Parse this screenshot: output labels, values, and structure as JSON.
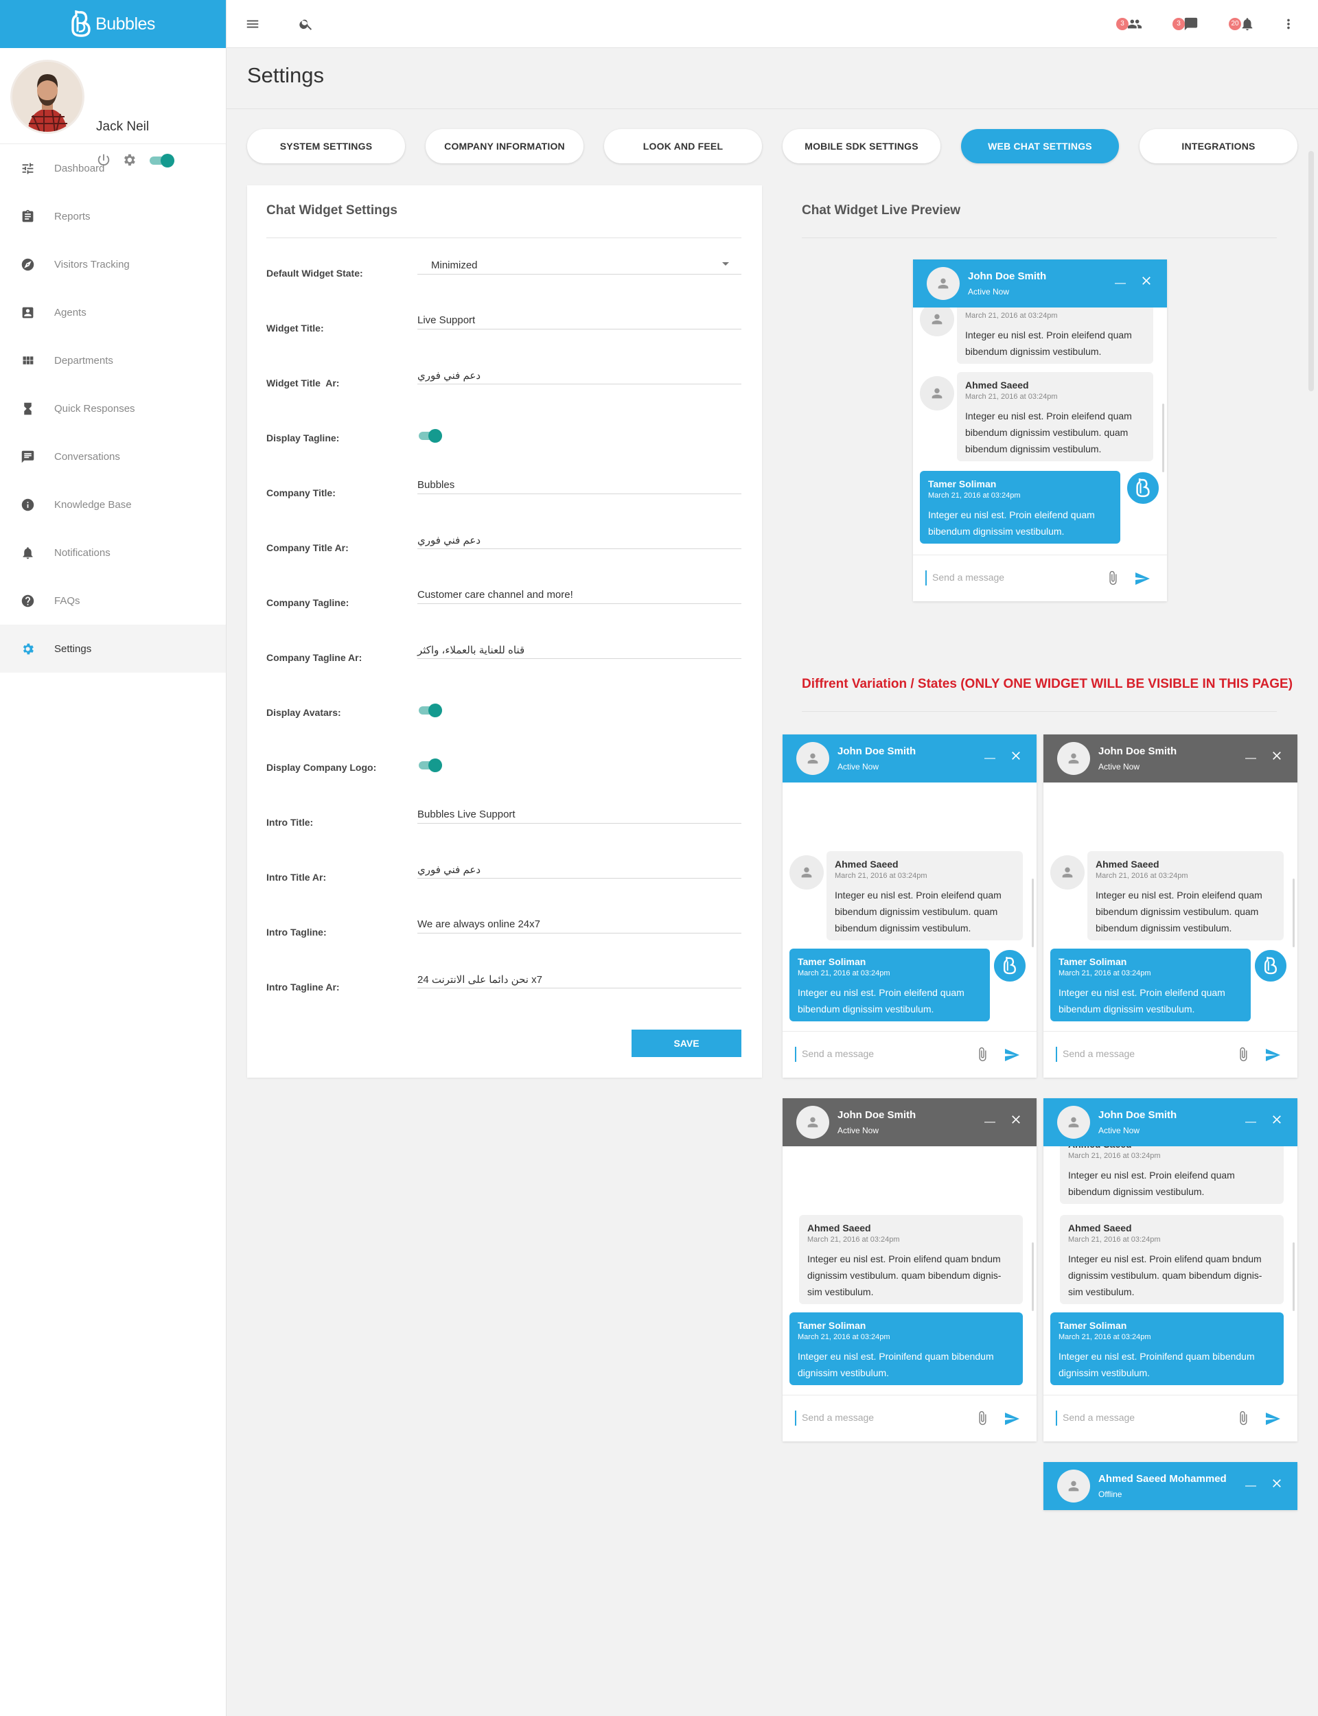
{
  "app": {
    "brand": "Bubbles"
  },
  "user": {
    "name": "Jack Neil",
    "online": true
  },
  "nav": {
    "items": [
      {
        "label": "Dashboard",
        "icon": "tune-icon"
      },
      {
        "label": "Reports",
        "icon": "clipboard-icon"
      },
      {
        "label": "Visitors Tracking",
        "icon": "compass-icon"
      },
      {
        "label": "Agents",
        "icon": "contact-icon"
      },
      {
        "label": "Departments",
        "icon": "grid-icon"
      },
      {
        "label": "Quick Responses",
        "icon": "hourglass-icon"
      },
      {
        "label": "Conversations",
        "icon": "chat-icon"
      },
      {
        "label": "Knowledge Base",
        "icon": "info-icon"
      },
      {
        "label": "Notifications",
        "icon": "bell-icon"
      },
      {
        "label": "FAQs",
        "icon": "help-icon"
      },
      {
        "label": "Settings",
        "icon": "gear-icon",
        "active": true
      }
    ]
  },
  "topbar": {
    "badges": {
      "visitors": "3",
      "chats": "3",
      "notifications": "20"
    }
  },
  "page": {
    "title": "Settings"
  },
  "tabs": [
    {
      "label": "SYSTEM SETTINGS"
    },
    {
      "label": "COMPANY INFORMATION"
    },
    {
      "label": "LOOK AND FEEL"
    },
    {
      "label": "MOBILE SDK SETTINGS"
    },
    {
      "label": "WEB CHAT SETTINGS",
      "active": true
    },
    {
      "label": "INTEGRATIONS"
    }
  ],
  "form": {
    "title": "Chat Widget Settings",
    "fields": [
      {
        "label": "Default Widget State:",
        "value": "Minimized",
        "type": "select"
      },
      {
        "label": "Widget Title:",
        "value": "Live Support"
      },
      {
        "label": "Widget Title  Ar:",
        "value": "دعم فني فوري"
      },
      {
        "label": "Display Tagline:",
        "type": "toggle",
        "on": true
      },
      {
        "label": "Company Title:",
        "value": "Bubbles"
      },
      {
        "label": "Company Title Ar:",
        "value": "دعم فني فوري"
      },
      {
        "label": "Company Tagline:",
        "value": "Customer care channel and more!"
      },
      {
        "label": "Company Tagline Ar:",
        "value": "قناه للعناية بالعملاء، واكثر"
      },
      {
        "label": "Display Avatars:",
        "type": "toggle",
        "on": true
      },
      {
        "label": "Display Company Logo:",
        "type": "toggle",
        "on": true
      },
      {
        "label": "Intro Title:",
        "value": "Bubbles Live Support"
      },
      {
        "label": "Intro Title Ar:",
        "value": "دعم فني فوري"
      },
      {
        "label": "Intro Tagline:",
        "value": "We are always online 24x7"
      },
      {
        "label": "Intro Tagline Ar:",
        "value": "24 نحن دائما على الانترنت x7"
      }
    ],
    "save_label": "SAVE"
  },
  "preview": {
    "title": "Chat Widget Live Preview",
    "variations_title": "Diffrent Variation / States (ONLY ONE WIDGET WILL BE VISIBLE IN THIS PAGE)"
  },
  "widget": {
    "agent_name": "John Doe Smith",
    "agent_status": "Active Now",
    "placeholder": "Send a message",
    "minimize": "—",
    "offline_name": "Ahmed Saeed Mohammed",
    "offline_status": "Offline"
  },
  "messages": {
    "ahmed_name": "Ahmed Saeed",
    "tamer_name": "Tamer Soliman",
    "date": "March 21, 2016 at 03:24pm",
    "text_short": "Integer eu nisl est. Proin eleifend quam bibendum dignissim vestibulum.",
    "text_long": "Integer eu nisl est. Proin eleifend quam bibendum dignissim vestibulum. quam bibendum dignissim vestibulum.",
    "text_long_b": "Integer eu nisl est. Proin elifend quam bndum dignissim vestibulum. quam bibendum dignis-sim vestibulum.",
    "text_me_b": "Integer eu nisl est. Proinifend quam bibendum dignissim vestibulum.",
    "ahmed_cut": "Ahmed Saeed"
  },
  "colors": {
    "accent": "#29a8e0",
    "toggle": "#149a8f",
    "header_gray": "#666666",
    "warning": "#d8202a"
  }
}
